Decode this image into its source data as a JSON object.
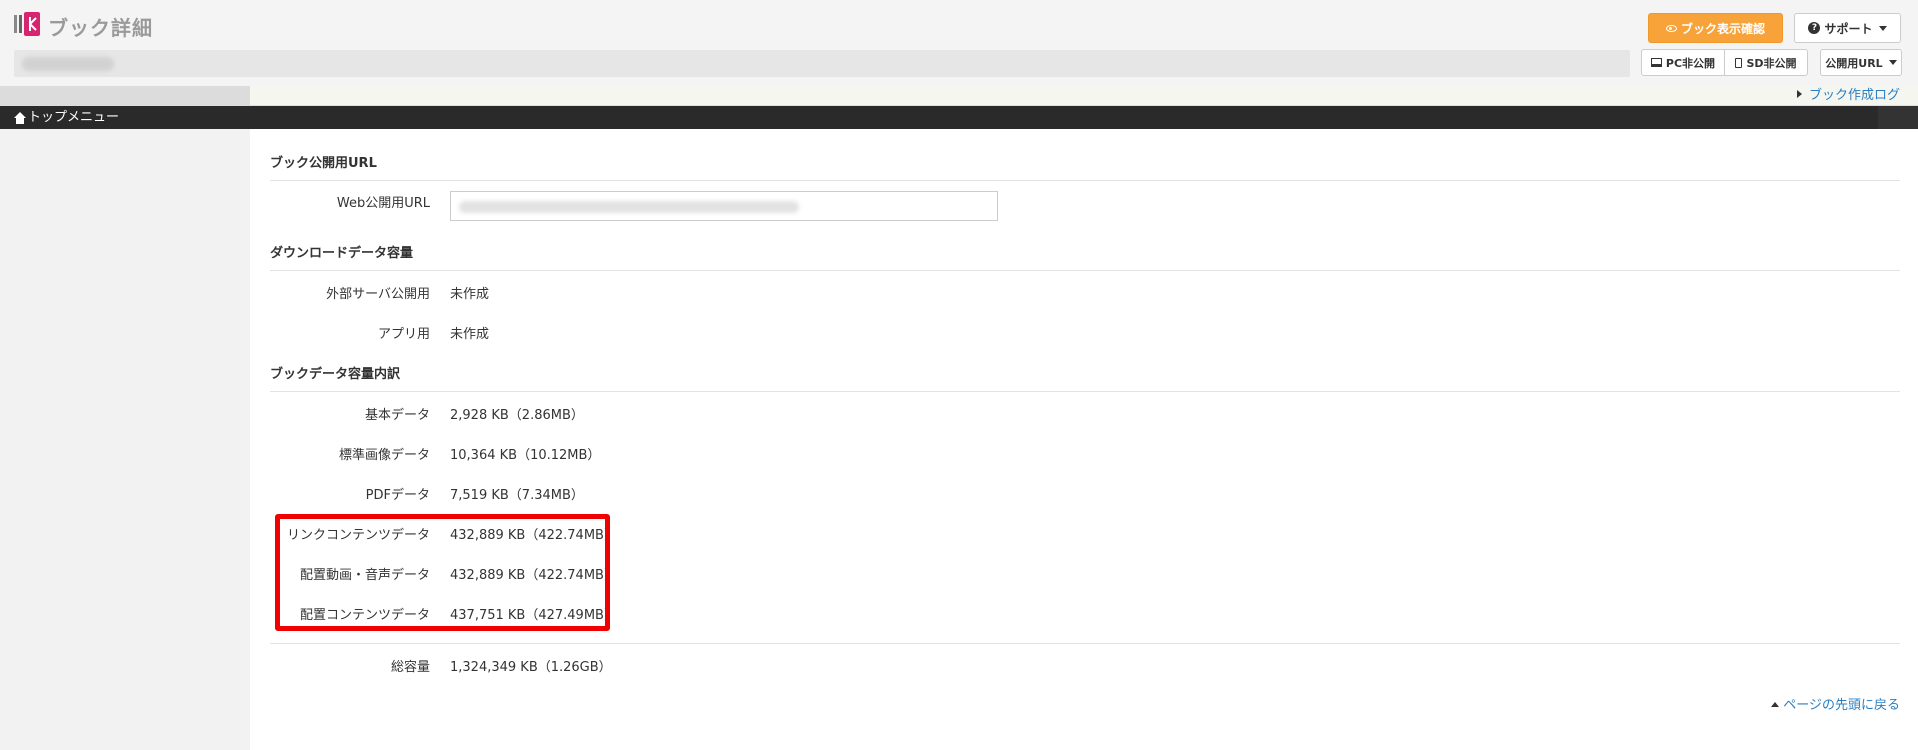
{
  "header": {
    "title": "ブック詳細",
    "preview_button": "ブック表示確認",
    "support_button": "サポート",
    "pc_button": "PC非公開",
    "sd_button": "SD非公開",
    "url_button": "公開用URL",
    "brand_color": "#d6246e",
    "preview_color": "#f7a33a"
  },
  "subnav": {
    "log_link": "ブック作成ログ",
    "home_link": "トップメニュー"
  },
  "sections": {
    "public_url": {
      "title": "ブック公開用URL",
      "web_label": "Web公開用URL"
    },
    "download": {
      "title": "ダウンロードデータ容量",
      "external_label": "外部サーバ公開用",
      "external_value": "未作成",
      "app_label": "アプリ用",
      "app_value": "未作成"
    },
    "breakdown": {
      "title": "ブックデータ容量内訳",
      "rows": [
        {
          "label": "基本データ",
          "value": "2,928 KB（2.86MB）"
        },
        {
          "label": "標準画像データ",
          "value": "10,364 KB（10.12MB）"
        },
        {
          "label": "PDFデータ",
          "value": "7,519 KB（7.34MB）"
        },
        {
          "label": "リンクコンテンツデータ",
          "value": "432,889 KB（422.74MB）"
        },
        {
          "label": "配置動画・音声データ",
          "value": "432,889 KB（422.74MB）"
        },
        {
          "label": "配置コンテンツデータ",
          "value": "437,751 KB（427.49MB）"
        }
      ],
      "total_label": "総容量",
      "total_value": "1,324,349 KB（1.26GB）"
    }
  },
  "footer": {
    "back_to_top": "ページの先頭に戻る"
  }
}
